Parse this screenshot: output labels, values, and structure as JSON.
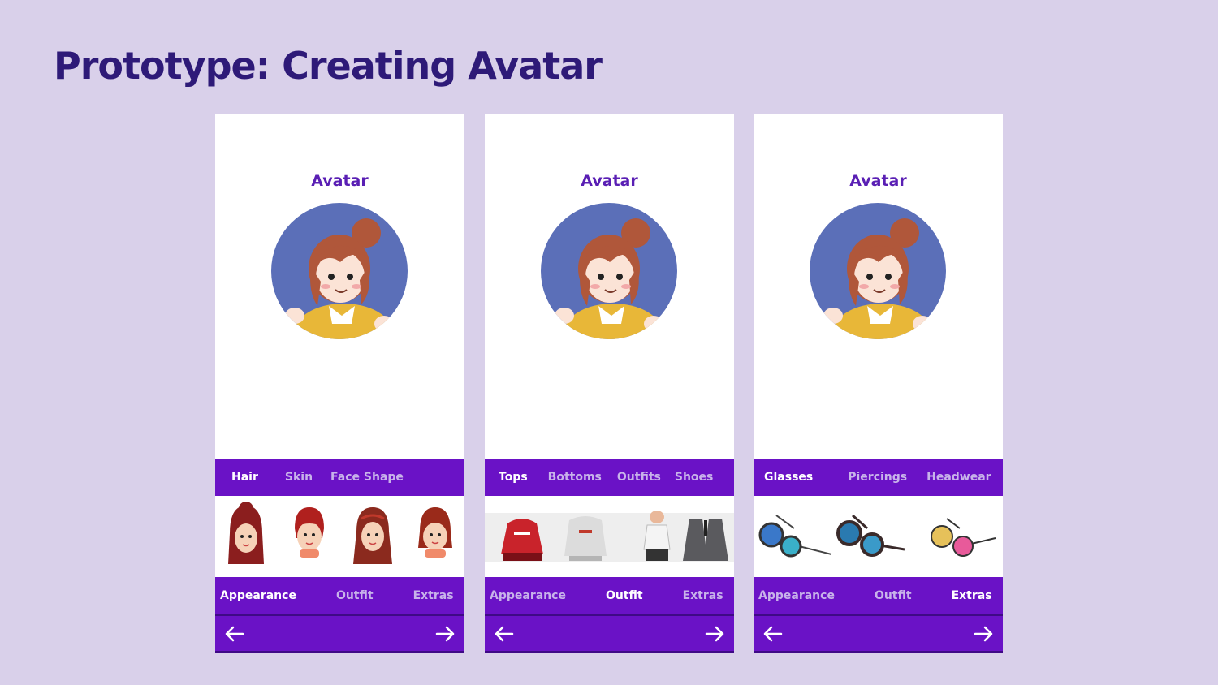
{
  "slide": {
    "title": "Prototype: Creating Avatar"
  },
  "screens": [
    {
      "heading": "Avatar",
      "subtabs": [
        "Hair",
        "Skin",
        "Face Shape"
      ],
      "active_subtab": "Hair",
      "items": [
        "hair-style-1",
        "hair-style-2",
        "hair-style-3",
        "hair-style-4"
      ],
      "maintabs": [
        "Appearance",
        "Outfit",
        "Extras"
      ],
      "active_maintab": "Appearance"
    },
    {
      "heading": "Avatar",
      "subtabs": [
        "Tops",
        "Bottoms",
        "Outfits",
        "Shoes"
      ],
      "active_subtab": "Tops",
      "items": [
        "top-red-hoodie",
        "top-white-hoodie",
        "top-tank",
        "top-blazer"
      ],
      "maintabs": [
        "Appearance",
        "Outfit",
        "Extras"
      ],
      "active_maintab": "Outfit"
    },
    {
      "heading": "Avatar",
      "subtabs": [
        "Glasses",
        "Piercings",
        "Headwear"
      ],
      "active_subtab": "Glasses",
      "items": [
        "glasses-blue",
        "glasses-dark",
        "glasses-pink"
      ],
      "maintabs": [
        "Appearance",
        "Outfit",
        "Extras"
      ],
      "active_maintab": "Extras"
    }
  ],
  "icons": {
    "back": "arrow-left-icon",
    "next": "arrow-right-icon"
  },
  "colors": {
    "background": "#d9d0ea",
    "title": "#2e1a78",
    "bar": "#6a12c6",
    "heading": "#5a1fb4",
    "avatar_circle": "#5b6fb8"
  }
}
